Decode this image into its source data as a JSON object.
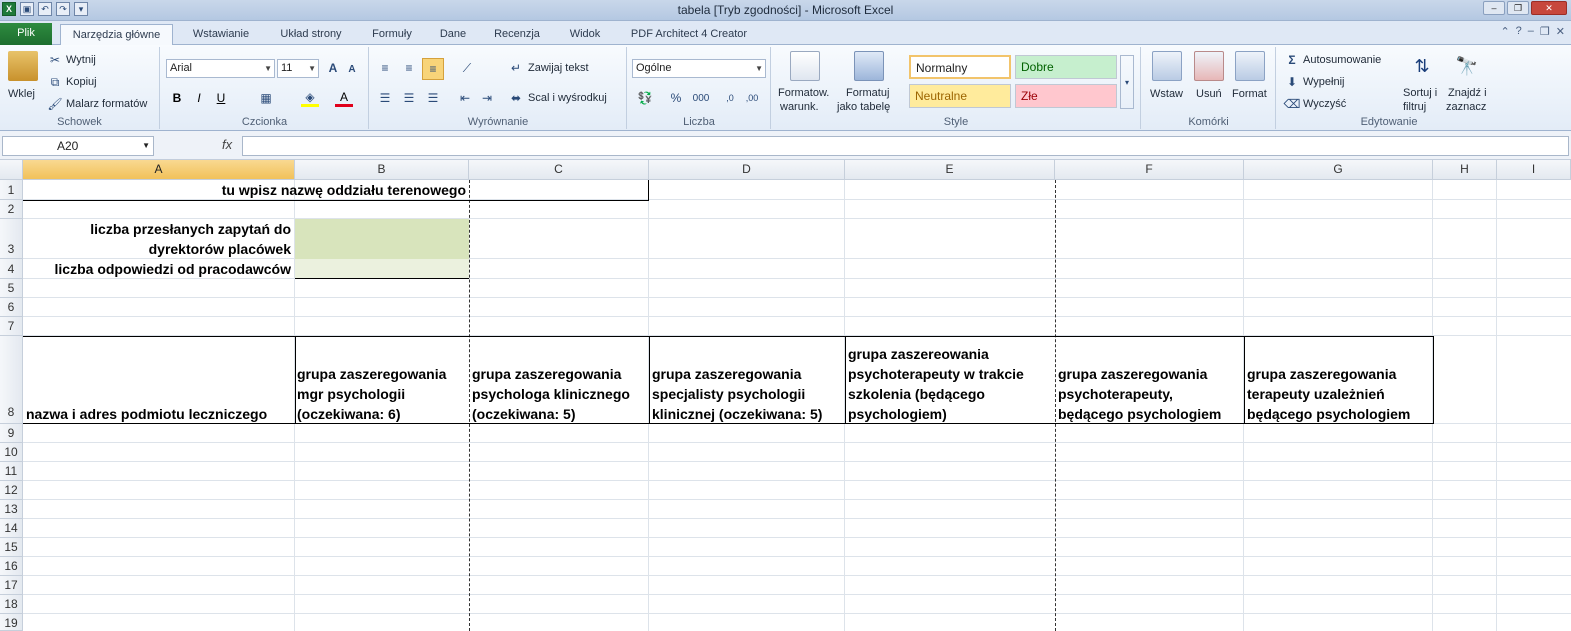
{
  "titlebar": {
    "title": "tabela  [Tryb zgodności]  -  Microsoft Excel"
  },
  "tabs": [
    "Plik",
    "Narzędzia główne",
    "Wstawianie",
    "Układ strony",
    "Formuły",
    "Dane",
    "Recenzja",
    "Widok",
    "PDF Architect 4 Creator"
  ],
  "ribbon": {
    "clipboard": {
      "paste": "Wklej",
      "cut": "Wytnij",
      "copy": "Kopiuj",
      "format_painter": "Malarz formatów",
      "label": "Schowek"
    },
    "font": {
      "name": "Arial",
      "size": "11",
      "label": "Czcionka"
    },
    "alignment": {
      "wrap": "Zawijaj tekst",
      "merge": "Scal i wyśrodkuj",
      "label": "Wyrównanie"
    },
    "number": {
      "format": "Ogólne",
      "label": "Liczba"
    },
    "styles": {
      "cond_format": "Formatow.",
      "cond_format2": "warunk.",
      "format_table": "Formatuj",
      "format_table2": "jako tabelę",
      "normal": "Normalny",
      "good": "Dobre",
      "neutral": "Neutralne",
      "bad": "Złe",
      "label": "Style"
    },
    "cells": {
      "insert": "Wstaw",
      "delete": "Usuń",
      "format": "Format",
      "label": "Komórki"
    },
    "editing": {
      "autosum": "Autosumowanie",
      "fill": "Wypełnij",
      "clear": "Wyczyść",
      "sort": "Sortuj i",
      "sort2": "filtruj",
      "find": "Znajdź i",
      "find2": "zaznacz",
      "label": "Edytowanie"
    }
  },
  "formula_bar": {
    "name_box": "A20",
    "fx": "fx",
    "formula": ""
  },
  "columns": [
    "A",
    "B",
    "C",
    "D",
    "E",
    "F",
    "G",
    "H",
    "I"
  ],
  "rows": [
    "1",
    "2",
    "3",
    "4",
    "5",
    "6",
    "7",
    "8",
    "9",
    "10",
    "11",
    "12",
    "13",
    "14",
    "15",
    "16",
    "17",
    "18",
    "19"
  ],
  "cells": {
    "A1": "tu wpisz nazwę oddziału terenowego",
    "A3_line1": "liczba przesłanych zapytań do",
    "A3_line2": "dyrektorów placówek",
    "A4": "liczba odpowiedzi od pracodawców",
    "A8": "nazwa i adres podmiotu leczniczego",
    "B8": [
      "grupa zaszeregowania",
      "mgr psychologii",
      "(oczekiwana: 6)"
    ],
    "C8": [
      "grupa zaszeregowania",
      "psychologa klinicznego",
      "(oczekiwana: 5)"
    ],
    "D8": [
      "grupa zaszeregowania",
      "specjalisty psychologii",
      "klinicznej (oczekiwana: 5)"
    ],
    "E8": [
      "grupa zaszereowania",
      "psychoterapeuty w trakcie",
      "szkolenia (będącego",
      "psychologiem)"
    ],
    "F8": [
      "grupa zaszeregowania",
      "psychoterapeuty,",
      "będącego psychologiem"
    ],
    "G8": [
      "grupa zaszeregowania",
      "terapeuty uzależnień",
      "będącego psychologiem"
    ]
  },
  "colors": {
    "input_fill": "#d8e4bc",
    "accent_file": "#1d6e2f",
    "header_active": "#f1c15a",
    "good": "#c6efce",
    "neutral": "#ffeb9c",
    "bad": "#ffc7ce"
  }
}
